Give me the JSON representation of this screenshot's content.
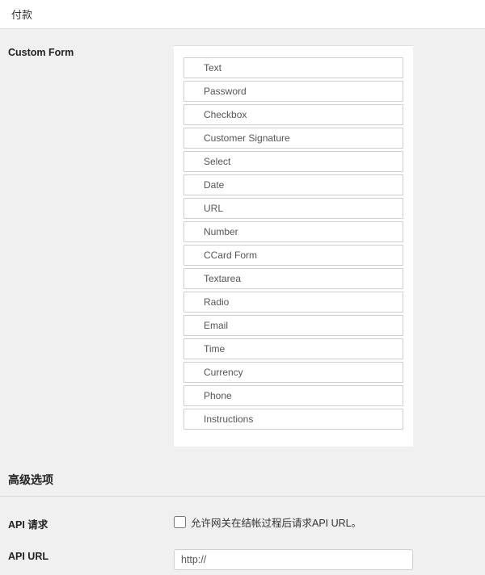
{
  "topNav": {
    "label": "付款"
  },
  "custom": {
    "label": "Custom Form",
    "fields": [
      "Text",
      "Password",
      "Checkbox",
      "Customer Signature",
      "Select",
      "Date",
      "URL",
      "Number",
      "CCard Form",
      "Textarea",
      "Radio",
      "Email",
      "Time",
      "Currency",
      "Phone",
      "Instructions"
    ]
  },
  "advanced": {
    "title": "高级选项"
  },
  "apiRequest": {
    "label": "API 请求",
    "checkboxLabel": "允许网关在结帐过程后请求API URL。"
  },
  "apiUrl": {
    "label": "API URL",
    "value": "http://"
  }
}
